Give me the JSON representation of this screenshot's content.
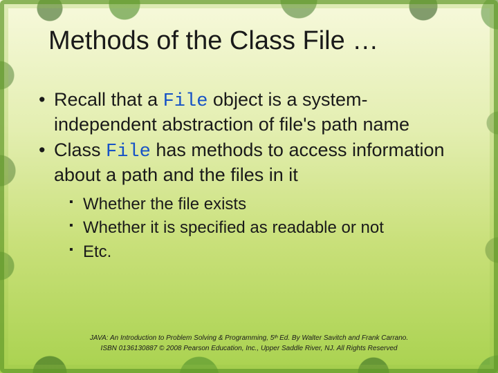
{
  "title": "Methods of the Class File …",
  "bullets": {
    "b1_pre": "Recall that a ",
    "b1_code": "File",
    "b1_post": " object is a system-independent abstraction of file's path name",
    "b2_pre": "Class ",
    "b2_code": "File",
    "b2_post": " has methods to access information about a path and the files in it",
    "sub1": "Whether the file exists",
    "sub2": "Whether it is specified as readable or not",
    "sub3": "Etc."
  },
  "footer": {
    "line1": "JAVA: An Introduction to Problem Solving & Programming, 5ᵗʰ Ed. By Walter Savitch and Frank Carrano.",
    "line2": "ISBN 0136130887 © 2008 Pearson Education, Inc., Upper Saddle River, NJ. All Rights Reserved"
  }
}
